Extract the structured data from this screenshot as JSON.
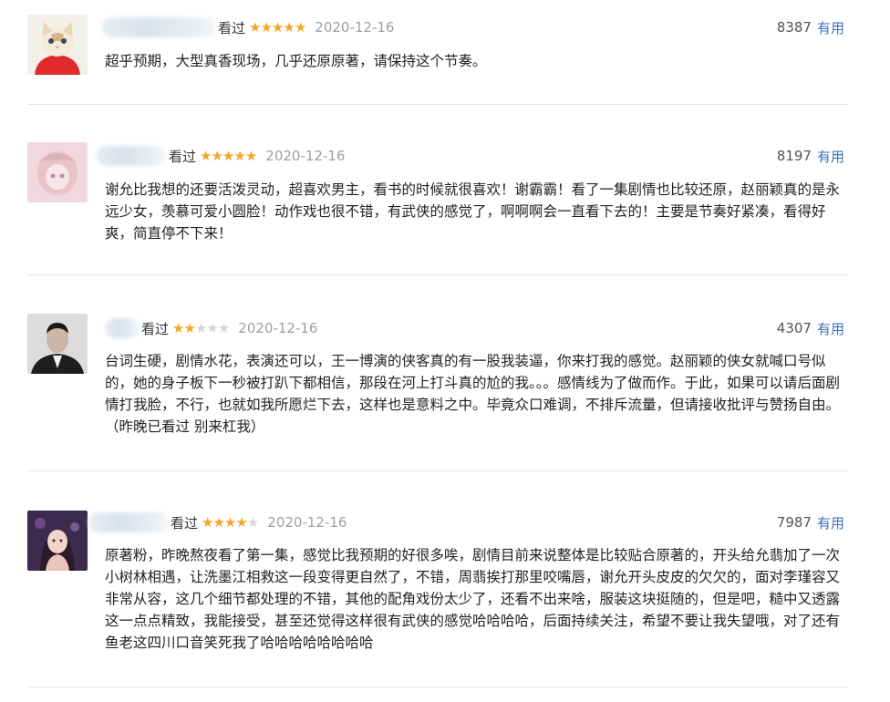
{
  "colors": {
    "star": "#f4a623",
    "star_empty": "#d6d6d6",
    "link": "#3b73b9",
    "date": "#9aa0a6"
  },
  "reviews": [
    {
      "avatar_icon": "cat-avatar-icon",
      "status": "看过",
      "rating": 5,
      "date": "2020-12-16",
      "votes": "8387",
      "useful": "有用",
      "text": "超乎预期，大型真香现场，几乎还原原著，请保持这个节奏。"
    },
    {
      "avatar_icon": "anime-girl-avatar-icon",
      "status": "看过",
      "rating": 5,
      "date": "2020-12-16",
      "votes": "8197",
      "useful": "有用",
      "text": "谢允比我想的还要活泼灵动，超喜欢男主，看书的时候就很喜欢！谢霸霸！看了一集剧情也比较还原，赵丽颖真的是永远少女，羡慕可爱小圆脸！动作戏也很不错，有武侠的感觉了，啊啊啊会一直看下去的！主要是节奏好紧凑，看得好爽，简直停不下来！"
    },
    {
      "avatar_icon": "man-portrait-avatar-icon",
      "status": "看过",
      "rating": 2,
      "date": "2020-12-16",
      "votes": "4307",
      "useful": "有用",
      "text": "台词生硬，剧情水花，表演还可以，王一博演的侠客真的有一股我装逼，你来打我的感觉。赵丽颖的侠女就喊口号似的，她的身子板下一秒被打趴下都相信，那段在河上打斗真的尬的我。。。感情线为了做而作。于此，如果可以请后面剧情打我脸，不行，也就如我所愿烂下去，这样也是意料之中。毕竟众口难调，不排斥流量，但请接收批评与赞扬自由。（昨晚已看过 别来杠我）"
    },
    {
      "avatar_icon": "woman-portrait-avatar-icon",
      "status": "看过",
      "rating": 4,
      "date": "2020-12-16",
      "votes": "7987",
      "useful": "有用",
      "text": "原著粉，昨晚熬夜看了第一集，感觉比我预期的好很多唉，剧情目前来说整体是比较贴合原著的，开头给允翡加了一次小树林相遇，让洗墨江相救这一段变得更自然了，不错，周翡挨打那里咬嘴唇，谢允开头皮皮的欠欠的，面对李瑾容又非常从容，这几个细节都处理的不错，其他的配角戏份太少了，还看不出来啥，服装这块挺随的，但是吧，糙中又透露这一点点精致，我能接受，甚至还觉得这样很有武侠的感觉哈哈哈哈，后面持续关注，希望不要让我失望哦，对了还有鱼老这四川口音笑死我了哈哈哈哈哈哈哈哈"
    }
  ]
}
